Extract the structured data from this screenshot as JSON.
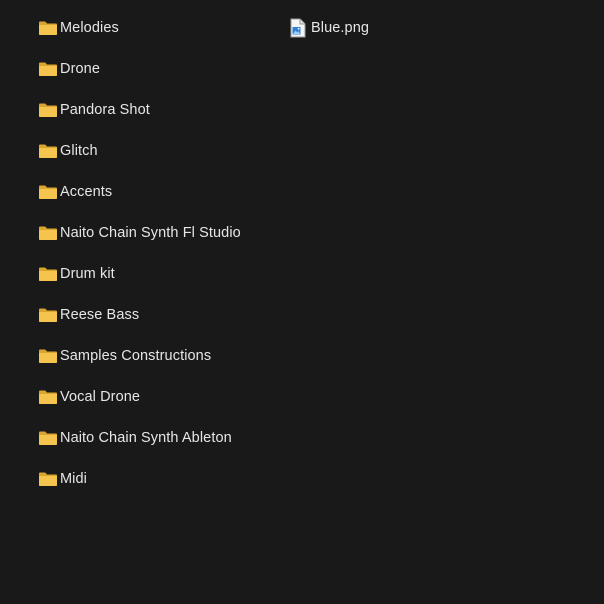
{
  "folders": [
    {
      "label": "Melodies"
    },
    {
      "label": "Drone"
    },
    {
      "label": "Pandora Shot"
    },
    {
      "label": "Glitch"
    },
    {
      "label": "Accents"
    },
    {
      "label": "Naito Chain Synth Fl Studio"
    },
    {
      "label": "Drum kit"
    },
    {
      "label": "Reese Bass"
    },
    {
      "label": "Samples Constructions"
    },
    {
      "label": "Vocal Drone"
    },
    {
      "label": "Naito Chain Synth Ableton"
    },
    {
      "label": "Midi"
    }
  ],
  "files": [
    {
      "label": "Blue.png"
    }
  ],
  "icons": {
    "folder": "folder-icon",
    "image_file": "image-file-icon"
  },
  "colors": {
    "background": "#191919",
    "text": "#e6e6e6",
    "folder": "#f2c04d"
  }
}
